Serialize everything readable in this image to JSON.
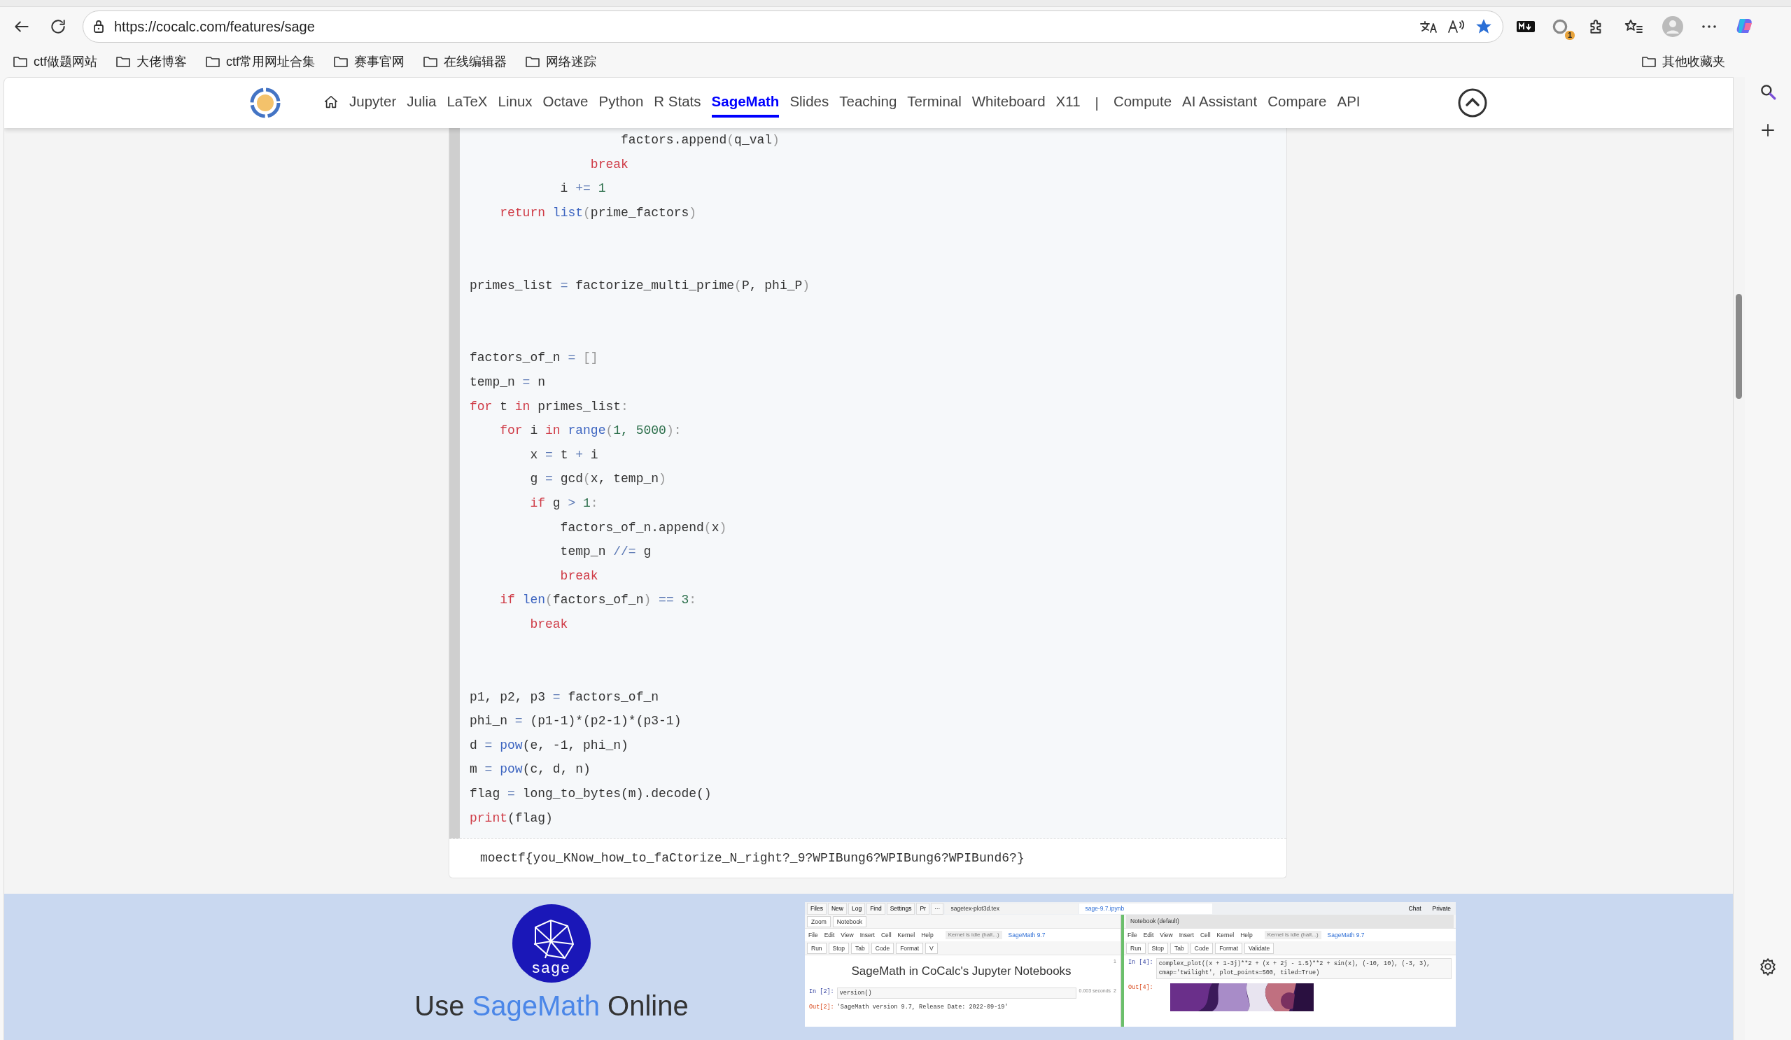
{
  "browser": {
    "url": "https://cocalc.com/features/sage",
    "favorite": true,
    "extension_badge": "1",
    "bookmarks": [
      "ctf做题网站",
      "大佬博客",
      "ctf常用网址合集",
      "赛事官网",
      "在线编辑器",
      "网络迷踪"
    ],
    "other_bookmarks": "其他收藏夹"
  },
  "navbar": {
    "items": [
      {
        "kind": "home",
        "selected": false
      },
      {
        "kind": "link",
        "label": "Jupyter",
        "selected": false
      },
      {
        "kind": "link",
        "label": "Julia",
        "selected": false
      },
      {
        "kind": "link",
        "label": "LaTeX",
        "selected": false
      },
      {
        "kind": "link",
        "label": "Linux",
        "selected": false
      },
      {
        "kind": "link",
        "label": "Octave",
        "selected": false
      },
      {
        "kind": "link",
        "label": "Python",
        "selected": false
      },
      {
        "kind": "link",
        "label": "R Stats",
        "selected": false
      },
      {
        "kind": "link",
        "label": "SageMath",
        "selected": true
      },
      {
        "kind": "link",
        "label": "Slides",
        "selected": false
      },
      {
        "kind": "link",
        "label": "Teaching",
        "selected": false
      },
      {
        "kind": "link",
        "label": "Terminal",
        "selected": false
      },
      {
        "kind": "link",
        "label": "Whiteboard",
        "selected": false
      },
      {
        "kind": "link",
        "label": "X11",
        "selected": false
      },
      {
        "kind": "separator",
        "label": "|"
      },
      {
        "kind": "link",
        "label": "Compute",
        "selected": false
      },
      {
        "kind": "link",
        "label": "AI Assistant",
        "selected": false
      },
      {
        "kind": "link",
        "label": "Compare",
        "selected": false
      },
      {
        "kind": "link",
        "label": "API",
        "selected": false
      }
    ]
  },
  "code": {
    "lines": [
      {
        "kind": "code",
        "tokens": [
          {
            "text": "                    factors.append",
            "kind": "plain"
          },
          {
            "text": "(",
            "kind": "punct"
          },
          {
            "text": "q_val",
            "kind": "plain"
          },
          {
            "text": ")",
            "kind": "punct"
          }
        ]
      },
      {
        "tokens": [
          {
            "text": "                break",
            "kind": "keyword"
          }
        ]
      },
      {
        "tokens": [
          {
            "text": "            i",
            "kind": "plain"
          },
          {
            "text": " += ",
            "kind": "operator"
          },
          {
            "text": "1",
            "kind": "number"
          }
        ]
      },
      {
        "tokens": [
          {
            "text": "    return ",
            "kind": "keyword"
          },
          {
            "text": "list",
            "kind": "builtin"
          },
          {
            "text": "(",
            "kind": "punct"
          },
          {
            "text": "prime_factors",
            "kind": "plain"
          },
          {
            "text": ")",
            "kind": "punct"
          }
        ]
      },
      {
        "kind": "blank"
      },
      {
        "kind": "blank"
      },
      {
        "kind": "code",
        "tokens": [
          {
            "text": "primes_list",
            "kind": "plain"
          },
          {
            "text": " = ",
            "kind": "operator"
          },
          {
            "text": "factorize_multi_prime",
            "kind": "plain"
          },
          {
            "text": "(",
            "kind": "punct"
          },
          {
            "text": "P, phi_P",
            "kind": "plain"
          },
          {
            "text": ")",
            "kind": "punct"
          }
        ]
      },
      {
        "kind": "blank"
      },
      {
        "kind": "blank"
      },
      {
        "kind": "code",
        "tokens": [
          {
            "text": "factors_of_n",
            "kind": "plain"
          },
          {
            "text": " = ",
            "kind": "operator"
          },
          {
            "text": "[]",
            "kind": "punct"
          }
        ]
      },
      {
        "tokens": [
          {
            "text": "temp_n",
            "kind": "plain"
          },
          {
            "text": " = ",
            "kind": "operator"
          },
          {
            "text": "n",
            "kind": "plain"
          }
        ]
      },
      {
        "tokens": [
          {
            "text": "for",
            "kind": "keyword"
          },
          {
            "text": " t ",
            "kind": "plain"
          },
          {
            "text": "in",
            "kind": "keyword"
          },
          {
            "text": " primes_list",
            "kind": "plain"
          },
          {
            "text": ":",
            "kind": "punct"
          }
        ]
      },
      {
        "tokens": [
          {
            "text": "    for",
            "kind": "keyword"
          },
          {
            "text": " i ",
            "kind": "plain"
          },
          {
            "text": "in ",
            "kind": "keyword"
          },
          {
            "text": "range",
            "kind": "builtin"
          },
          {
            "text": "(",
            "kind": "punct"
          },
          {
            "text": "1, 5000",
            "kind": "number"
          },
          {
            "text": "):",
            "kind": "punct"
          }
        ]
      },
      {
        "tokens": [
          {
            "text": "        x",
            "kind": "plain"
          },
          {
            "text": " = ",
            "kind": "operator"
          },
          {
            "text": "t ",
            "kind": "plain"
          },
          {
            "text": "+",
            "kind": "operator"
          },
          {
            "text": " i",
            "kind": "plain"
          }
        ]
      },
      {
        "tokens": [
          {
            "text": "        g",
            "kind": "plain"
          },
          {
            "text": " = ",
            "kind": "operator"
          },
          {
            "text": "gcd",
            "kind": "plain"
          },
          {
            "text": "(",
            "kind": "punct"
          },
          {
            "text": "x, temp_n",
            "kind": "plain"
          },
          {
            "text": ")",
            "kind": "punct"
          }
        ]
      },
      {
        "tokens": [
          {
            "text": "        if",
            "kind": "keyword"
          },
          {
            "text": " g ",
            "kind": "plain"
          },
          {
            "text": ">",
            "kind": "operator"
          },
          {
            "text": " 1",
            "kind": "number"
          },
          {
            "text": ":",
            "kind": "punct"
          }
        ]
      },
      {
        "tokens": [
          {
            "text": "            factors_of_n.append",
            "kind": "plain"
          },
          {
            "text": "(",
            "kind": "punct"
          },
          {
            "text": "x",
            "kind": "plain"
          },
          {
            "text": ")",
            "kind": "punct"
          }
        ]
      },
      {
        "tokens": [
          {
            "text": "            temp_n",
            "kind": "plain"
          },
          {
            "text": " //= ",
            "kind": "operator"
          },
          {
            "text": "g",
            "kind": "plain"
          }
        ]
      },
      {
        "tokens": [
          {
            "text": "            break",
            "kind": "keyword"
          }
        ]
      },
      {
        "tokens": [
          {
            "text": "    if ",
            "kind": "keyword"
          },
          {
            "text": "len",
            "kind": "builtin"
          },
          {
            "text": "(",
            "kind": "punct"
          },
          {
            "text": "factors_of_n",
            "kind": "plain"
          },
          {
            "text": ")",
            "kind": "punct"
          },
          {
            "text": " == ",
            "kind": "operator"
          },
          {
            "text": "3",
            "kind": "number"
          },
          {
            "text": ":",
            "kind": "punct"
          }
        ]
      },
      {
        "tokens": [
          {
            "text": "        break",
            "kind": "keyword"
          }
        ]
      },
      {
        "kind": "blank"
      },
      {
        "kind": "blank"
      },
      {
        "kind": "code",
        "tokens": [
          {
            "text": "p1, p2, p3",
            "kind": "plain"
          },
          {
            "text": " = ",
            "kind": "operator"
          },
          {
            "text": "factors_of_n",
            "kind": "plain"
          }
        ]
      },
      {
        "tokens": [
          {
            "text": "phi_n",
            "kind": "plain"
          },
          {
            "text": " = ",
            "kind": "operator"
          },
          {
            "text": "(p1-1)*(p2-1)*(p3-1)",
            "kind": "plain"
          }
        ]
      },
      {
        "tokens": [
          {
            "text": "d",
            "kind": "plain"
          },
          {
            "text": " = ",
            "kind": "operator"
          },
          {
            "text": "pow",
            "kind": "builtin"
          },
          {
            "text": "(e, -1, phi_n)",
            "kind": "plain"
          }
        ]
      },
      {
        "tokens": [
          {
            "text": "m",
            "kind": "plain"
          },
          {
            "text": " = ",
            "kind": "operator"
          },
          {
            "text": "pow",
            "kind": "builtin"
          },
          {
            "text": "(c, d, n)",
            "kind": "plain"
          }
        ]
      },
      {
        "tokens": [
          {
            "text": "flag",
            "kind": "plain"
          },
          {
            "text": " = ",
            "kind": "operator"
          },
          {
            "text": "long_to_bytes(m).decode()",
            "kind": "plain"
          }
        ]
      },
      {
        "tokens": [
          {
            "text": "print",
            "kind": "keyword"
          },
          {
            "text": "(flag)",
            "kind": "plain"
          }
        ]
      }
    ],
    "output": "moectf{you_KNow_how_to_faCtorize_N_right?_9?WPIBung6?WPIBung6?WPIBund6?}"
  },
  "promo": {
    "logo_text": "sage",
    "heading": {
      "before": "Use",
      "highlight": "SageMath",
      "after": "Online"
    },
    "preview": {
      "top_tabs": [
        "Files",
        "New",
        "Log",
        "Find",
        "Settings",
        "Pr"
      ],
      "more": "···",
      "file_tabs": [
        {
          "label": "sagetex-plot3d.tex",
          "selected": false
        },
        {
          "label": "sage-9.7.ipynb",
          "selected": true
        }
      ],
      "chat": "Chat",
      "private": "Private",
      "panes": [
        {
          "kind": "notebook",
          "zoom": "Zoom",
          "view": "Notebook",
          "menus": [
            "File",
            "Edit",
            "View",
            "Insert",
            "Cell",
            "Kernel",
            "Help"
          ],
          "kernel_status": "Kernel is idle (halt...)",
          "kernel": "SageMath 9.7",
          "buttons": [
            "Run",
            "Stop",
            "Tab",
            "Code",
            "Format",
            "V"
          ],
          "cells": [
            {
              "kind": "heading",
              "text": "SageMath in CoCalc's Jupyter Notebooks",
              "number": "1"
            },
            {
              "kind": "code",
              "in_prompt": "In [2]:",
              "input": "version()",
              "timing": "0.003 seconds",
              "number": "2",
              "out_prompt": "Out[2]:",
              "output": "'SageMath version 9.7, Release Date: 2022-09-19'"
            }
          ]
        },
        {
          "kind": "frame",
          "title": "Notebook (default)",
          "menus": [
            "File",
            "Edit",
            "View",
            "Insert",
            "Cell",
            "Kernel",
            "Help"
          ],
          "kernel_status": "Kernel is idle (halt...)",
          "kernel": "SageMath 9.7",
          "buttons": [
            "Run",
            "Stop",
            "Tab",
            "Code",
            "Format",
            "Validate"
          ],
          "cells": [
            {
              "kind": "code",
              "in_prompt": "In [4]:",
              "input": "complex_plot((x + 1-3j)**2 + (x + 2j - 1.5)**2 + sin(x), (-10, 10), (-3, 3), cmap='twilight', plot_points=500, tiled=True)",
              "out_prompt": "Out[4]:"
            }
          ]
        }
      ]
    }
  }
}
